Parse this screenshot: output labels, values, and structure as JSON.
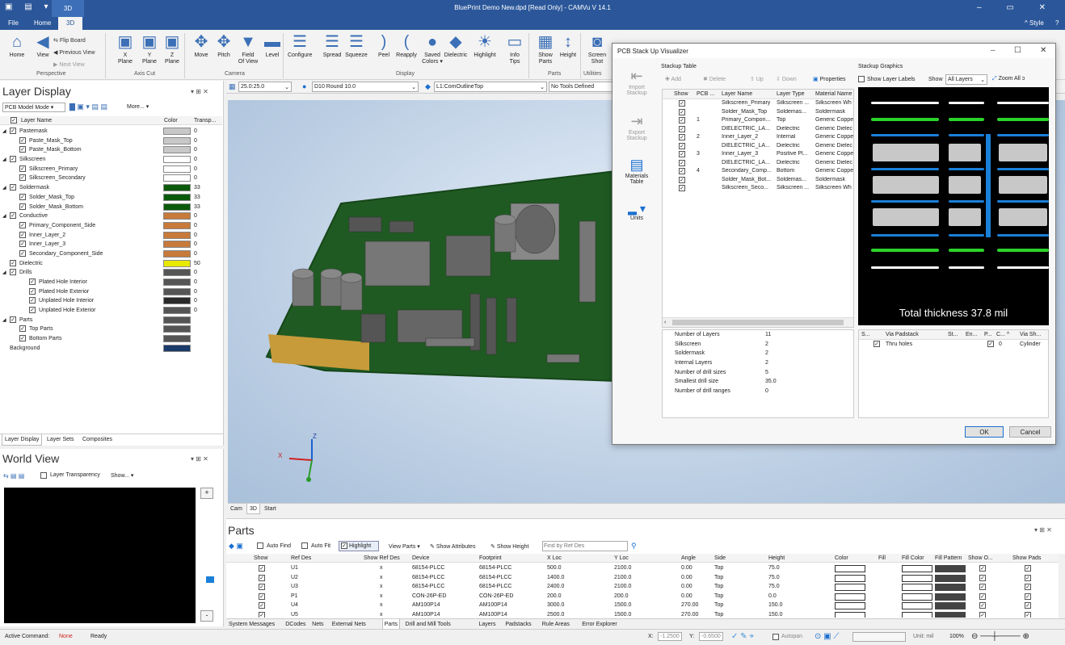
{
  "app": {
    "title": "BluePrint Demo New.dpd [Read Only] - CAMVu V 14.1",
    "context_tab": "3D",
    "window_controls": "– ▭ ✕"
  },
  "menu_tabs": [
    "File",
    "Home",
    "3D"
  ],
  "menu_right": {
    "style": "^ Style",
    "help": "?"
  },
  "ribbon": {
    "groups": [
      "Perspective",
      "Axis Cut",
      "Camera",
      "Display",
      "Parts",
      "Utilities"
    ],
    "buttons": [
      {
        "label": "Home",
        "icon": "⌂"
      },
      {
        "label": "View",
        "icon": "◀"
      },
      {
        "label": "X\nPlane",
        "icon": "▣"
      },
      {
        "label": "Y\nPlane",
        "icon": "▣"
      },
      {
        "label": "Z\nPlane",
        "icon": "▣"
      },
      {
        "label": "Move",
        "icon": "✥"
      },
      {
        "label": "Pitch",
        "icon": "✥"
      },
      {
        "label": "Field\nOf View",
        "icon": "▼"
      },
      {
        "label": "Level",
        "icon": "▬"
      },
      {
        "label": "Configure",
        "icon": "☰"
      },
      {
        "label": "Spread",
        "icon": "☰"
      },
      {
        "label": "Squeeze",
        "icon": "☰"
      },
      {
        "label": "Peel",
        "icon": ")"
      },
      {
        "label": "Reapply",
        "icon": "("
      },
      {
        "label": "Saved\nColors ▾",
        "icon": "●"
      },
      {
        "label": "Dielectric",
        "icon": "◆"
      },
      {
        "label": "Highlight",
        "icon": "☀"
      },
      {
        "label": "Info\nTips",
        "icon": "▭"
      },
      {
        "label": "Show\nParts",
        "icon": "▦"
      },
      {
        "label": "Height",
        "icon": "↕"
      },
      {
        "label": "Screen\nShot",
        "icon": "◙"
      }
    ],
    "small_buttons": [
      "Flip Board",
      "Previous View",
      "Next View"
    ]
  },
  "toolbar": {
    "zoom_value": "25.0:25.0",
    "dcode": "D10  Round 10.0",
    "layer": "L1:ComOutlineTop",
    "tools": "No Tools Defined"
  },
  "layer_display": {
    "title": "Layer Display",
    "mode": "PCB Model Mode",
    "more": "More...",
    "headers": [
      "Layer Name",
      "Color",
      "Transp..."
    ],
    "rows": [
      {
        "name": "Pastemask",
        "color": "#c8c8c8",
        "t": "0",
        "level": 0,
        "group": true
      },
      {
        "name": "Paste_Mask_Top",
        "color": "#c8c8c8",
        "t": "0",
        "level": 1
      },
      {
        "name": "Paste_Mask_Bottom",
        "color": "#c8c8c8",
        "t": "0",
        "level": 1
      },
      {
        "name": "Silkscreen",
        "color": "#ffffff",
        "t": "0",
        "level": 0,
        "group": true
      },
      {
        "name": "Silkscreen_Primary",
        "color": "#ffffff",
        "t": "0",
        "level": 1
      },
      {
        "name": "Silkscreen_Secondary",
        "color": "#ffffff",
        "t": "0",
        "level": 1
      },
      {
        "name": "Soldermask",
        "color": "#0b5a0b",
        "t": "33",
        "level": 0,
        "group": true
      },
      {
        "name": "Solder_Mask_Top",
        "color": "#0b5a0b",
        "t": "33",
        "level": 1
      },
      {
        "name": "Solder_Mask_Bottom",
        "color": "#0b5a0b",
        "t": "33",
        "level": 1
      },
      {
        "name": "Conductive",
        "color": "#c77a3a",
        "t": "0",
        "level": 0,
        "group": true
      },
      {
        "name": "Primary_Component_Side",
        "color": "#c77a3a",
        "t": "0",
        "level": 1
      },
      {
        "name": "Inner_Layer_2",
        "color": "#c77a3a",
        "t": "0",
        "level": 1
      },
      {
        "name": "Inner_Layer_3",
        "color": "#c77a3a",
        "t": "0",
        "level": 1
      },
      {
        "name": "Secondary_Component_Side",
        "color": "#c77a3a",
        "t": "0",
        "level": 1
      },
      {
        "name": "Dielectric",
        "color": "#e8e800",
        "t": "50",
        "level": 0
      },
      {
        "name": "Drills",
        "color": "#555555",
        "t": "0",
        "level": 0,
        "group": true
      },
      {
        "name": "Plated Hole Interior",
        "color": "#555555",
        "t": "0",
        "level": 2
      },
      {
        "name": "Plated Hole Exterior",
        "color": "#555555",
        "t": "0",
        "level": 2
      },
      {
        "name": "Unplated Hole Interior",
        "color": "#2a2a2a",
        "t": "0",
        "level": 2
      },
      {
        "name": "Unplated Hole Exterior",
        "color": "#555555",
        "t": "0",
        "level": 2
      },
      {
        "name": "Parts",
        "color": "#555555",
        "t": "",
        "level": 0,
        "group": true
      },
      {
        "name": "Top Parts",
        "color": "#555555",
        "t": "",
        "level": 1
      },
      {
        "name": "Bottom Parts",
        "color": "#555555",
        "t": "",
        "level": 1
      },
      {
        "name": "Background",
        "color": "#1a3a6a",
        "t": "",
        "level": 0,
        "nocheck": true
      }
    ],
    "bottom_tabs": [
      "Layer Display",
      "Layer Sets",
      "Composites"
    ]
  },
  "world_view": {
    "title": "World View",
    "transparency": "Layer Transparency",
    "show": "Show... ▾"
  },
  "view_tabs": [
    "Cam",
    "3D",
    "Start"
  ],
  "axis": {
    "z": "Z",
    "x": "X"
  },
  "dialog": {
    "title": "PCB Stack Up Visualizer",
    "side_buttons": [
      "Import\nStackup",
      "Export\nStackup",
      "Materials\nTable",
      "Units"
    ],
    "stackup_table_label": "Stackup Table",
    "toolbar": [
      "Add",
      "Delete",
      "Up",
      "Down",
      "Properties"
    ],
    "headers": [
      "Show",
      "PCB ...",
      "Layer Name",
      "Layer Type",
      "Material Name"
    ],
    "rows": [
      {
        "pcb": "",
        "name": "Silkscreen_Primary",
        "type": "Silkscreen ...",
        "mat": "Silkscreen Wh"
      },
      {
        "pcb": "",
        "name": "Solder_Mask_Top",
        "type": "Soldemas...",
        "mat": "Soldermask"
      },
      {
        "pcb": "1",
        "name": "Primary_Compon...",
        "type": "Top",
        "mat": "Generic Coppe"
      },
      {
        "pcb": "",
        "name": "DIELECTRIC_LA...",
        "type": "Dielectric",
        "mat": "Generic Dielec"
      },
      {
        "pcb": "2",
        "name": "Inner_Layer_2",
        "type": "Internal",
        "mat": "Generic Coppe"
      },
      {
        "pcb": "",
        "name": "DIELECTRIC_LA...",
        "type": "Dielectric",
        "mat": "Generic Dielec"
      },
      {
        "pcb": "3",
        "name": "Inner_Layer_3",
        "type": "Positive Pl...",
        "mat": "Generic Coppe"
      },
      {
        "pcb": "",
        "name": "DIELECTRIC_LA...",
        "type": "Dielectric",
        "mat": "Generic Dielec"
      },
      {
        "pcb": "4",
        "name": "Secondary_Comp...",
        "type": "Bottom",
        "mat": "Generic Coppe"
      },
      {
        "pcb": "",
        "name": "Solder_Mask_Bot...",
        "type": "Soldemas...",
        "mat": "Soldermask"
      },
      {
        "pcb": "",
        "name": "Silkscreen_Seco...",
        "type": "Silkscreen ...",
        "mat": "Silkscreen Wh"
      }
    ],
    "stats": [
      [
        "Number of Layers",
        "11"
      ],
      [
        "Silkscreen",
        "2"
      ],
      [
        "Soldermask",
        "2"
      ],
      [
        "Internal Layers",
        "2"
      ],
      [
        "Number of drill sizes",
        "5"
      ],
      [
        "Smallest drill size",
        "35.0"
      ],
      [
        "Number of drill ranges",
        "0"
      ]
    ],
    "graphics_label": "Stackup Graphics",
    "show_layer_labels": "Show Layer Labels",
    "show": "Show",
    "show_value": "All Layers",
    "zoom_all": "Zoom All",
    "total": "Total thickness 37.8 mil",
    "via_headers": [
      "S...",
      "Via Padstack",
      "St...",
      "En...",
      "P...",
      "C... ^",
      "Via Sh..."
    ],
    "via_rows": [
      {
        "name": "Thru holes",
        "c": "0",
        "shape": "Cylinder"
      }
    ],
    "ok": "OK",
    "cancel": "Cancel"
  },
  "parts": {
    "title": "Parts",
    "toolbar": {
      "auto_find": "Auto Find",
      "auto_fit": "Auto Fit",
      "highlight": "Highlight",
      "view_parts": "View Parts ▾",
      "show_attr": "Show Attributes",
      "show_height": "Show Height",
      "find_placeholder": "Find by Ref Des"
    },
    "headers": [
      "Show",
      "Ref Des",
      "Show Ref Des",
      "Device",
      "Footprint",
      "X Loc",
      "Y Loc",
      "Angle",
      "Side",
      "Height",
      "Color",
      "Fill",
      "Fill Color",
      "Fill Pattern",
      "Show O...",
      "Show Pads"
    ],
    "rows": [
      {
        "ref": "U1",
        "srd": "x",
        "dev": "68154-PLCC",
        "fp": "68154-PLCC",
        "x": "500.0",
        "y": "2100.0",
        "a": "0.00",
        "side": "Top",
        "h": "75.0"
      },
      {
        "ref": "U2",
        "srd": "x",
        "dev": "68154-PLCC",
        "fp": "68154-PLCC",
        "x": "1400.0",
        "y": "2100.0",
        "a": "0.00",
        "side": "Top",
        "h": "75.0"
      },
      {
        "ref": "U3",
        "srd": "x",
        "dev": "68154-PLCC",
        "fp": "68154-PLCC",
        "x": "2400.0",
        "y": "2100.0",
        "a": "0.00",
        "side": "Top",
        "h": "75.0"
      },
      {
        "ref": "P1",
        "srd": "x",
        "dev": "CON-26P-ED",
        "fp": "CON-26P-ED",
        "x": "200.0",
        "y": "200.0",
        "a": "0.00",
        "side": "Top",
        "h": "0.0"
      },
      {
        "ref": "U4",
        "srd": "x",
        "dev": "AM100P14",
        "fp": "AM100P14",
        "x": "3000.0",
        "y": "1500.0",
        "a": "270.00",
        "side": "Top",
        "h": "150.0"
      },
      {
        "ref": "U5",
        "srd": "x",
        "dev": "AM100P14",
        "fp": "AM100P14",
        "x": "2500.0",
        "y": "1500.0",
        "a": "270.00",
        "side": "Top",
        "h": "150.0"
      }
    ],
    "bottom_tabs": [
      "System Messages",
      "DCodes",
      "Nets",
      "External Nets",
      "Parts",
      "Drill and Mill Tools",
      "Layers",
      "Padstacks",
      "Rule Areas",
      "Error Explorer"
    ]
  },
  "status": {
    "active_label": "Active Command:",
    "active_value": "None",
    "ready": "Ready",
    "x_label": "X:",
    "x_val": "-1.2500",
    "y_label": "Y:",
    "y_val": "-0.6500",
    "autopan": "Autopan",
    "unit": "Unit: mil",
    "zoom": "100%"
  }
}
